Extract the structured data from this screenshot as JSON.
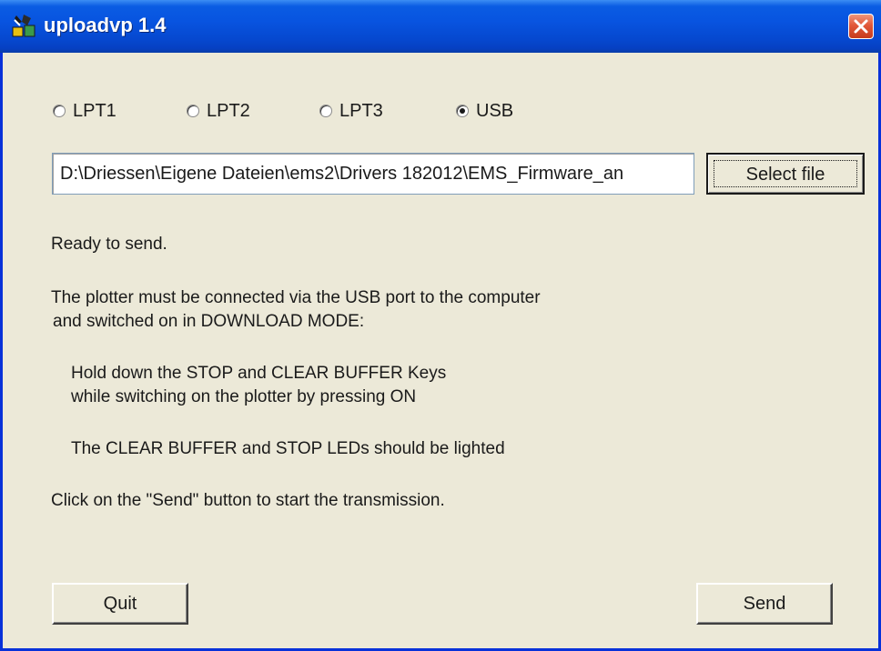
{
  "window": {
    "title": "uploadvp 1.4"
  },
  "ports": {
    "options": [
      {
        "label": "LPT1",
        "checked": false
      },
      {
        "label": "LPT2",
        "checked": false
      },
      {
        "label": "LPT3",
        "checked": false
      },
      {
        "label": "USB",
        "checked": true
      }
    ]
  },
  "file": {
    "path": "D:\\Driessen\\Eigene Dateien\\ems2\\Drivers 182012\\EMS_Firmware_an",
    "select_label": "Select file"
  },
  "status": "Ready to send.",
  "instructions": {
    "line1": "The plotter must be connected via the USB port to the computer",
    "line2": "and switched on in DOWNLOAD MODE:",
    "line3": "Hold down the STOP and CLEAR BUFFER Keys",
    "line4": "while switching on the plotter by pressing ON",
    "line5": "The CLEAR BUFFER and STOP LEDs should be lighted",
    "line6": "Click on the \"Send\" button to start the transmission."
  },
  "buttons": {
    "quit": "Quit",
    "send": "Send"
  },
  "colors": {
    "titlebar": "#0854e0",
    "close": "#e2583a",
    "face": "#ece9d8"
  }
}
